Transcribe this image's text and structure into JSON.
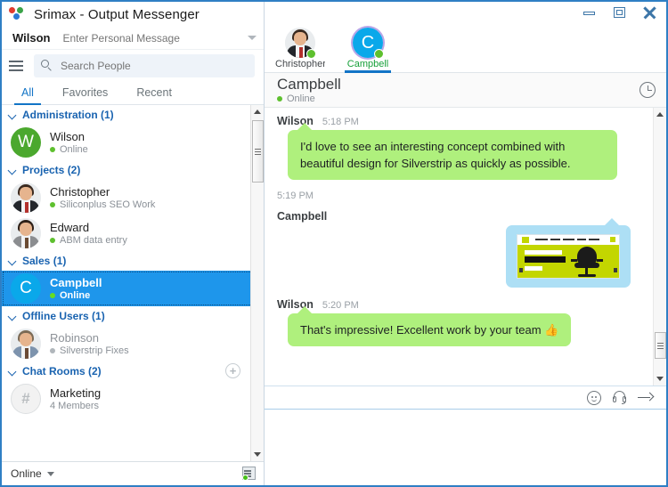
{
  "app": {
    "title": "Srimax - Output Messenger",
    "logo_icon": "three-dots-logo"
  },
  "window_controls": {
    "minimize": "minimize-icon",
    "maximize": "maximize-icon",
    "close": "close-icon"
  },
  "left_panel": {
    "user": {
      "name": "Wilson",
      "personal_message_placeholder": "Enter Personal Message"
    },
    "menu_icon": "hamburger-icon",
    "search": {
      "placeholder": "Search People",
      "icon": "search-icon"
    },
    "tabs": [
      {
        "label": "All",
        "active": true
      },
      {
        "label": "Favorites",
        "active": false
      },
      {
        "label": "Recent",
        "active": false
      }
    ],
    "groups": [
      {
        "label": "Administration (1)",
        "contacts": [
          {
            "name": "Wilson",
            "status": "Online",
            "avatar_type": "letter",
            "avatar_letter": "W",
            "avatar_color": "#4ba82e",
            "selected": false,
            "offline": false
          }
        ]
      },
      {
        "label": "Projects (2)",
        "contacts": [
          {
            "name": "Christopher",
            "status": "Siliconplus SEO Work",
            "avatar_type": "photo",
            "selected": false,
            "offline": false
          },
          {
            "name": "Edward",
            "status": "ABM data entry",
            "avatar_type": "photo",
            "selected": false,
            "offline": false
          }
        ]
      },
      {
        "label": "Sales (1)",
        "contacts": [
          {
            "name": "Campbell",
            "status": "Online",
            "avatar_type": "letter",
            "avatar_letter": "C",
            "avatar_color": "#0aa8ea",
            "selected": true,
            "offline": false
          }
        ]
      },
      {
        "label": "Offline Users (1)",
        "contacts": [
          {
            "name": "Robinson",
            "status": "Silverstrip Fixes",
            "avatar_type": "photo",
            "selected": false,
            "offline": true
          }
        ]
      },
      {
        "label": "Chat Rooms (2)",
        "add_button": "+",
        "contacts": [
          {
            "name": "Marketing",
            "status": "4 Members",
            "avatar_type": "hash",
            "avatar_letter": "#",
            "selected": false,
            "offline": false,
            "no_dot": true
          }
        ]
      }
    ],
    "status_bar": {
      "status": "Online",
      "network_icon": "network-status-icon"
    }
  },
  "chat_panel": {
    "tabs": [
      {
        "label": "Christopher",
        "avatar_type": "photo",
        "presence": "online",
        "active": false
      },
      {
        "label": "Campbell",
        "avatar_type": "letter",
        "avatar_letter": "C",
        "presence": "online",
        "active": true
      }
    ],
    "conversation_header": {
      "name": "Campbell",
      "status": "Online",
      "history_icon": "clock-history-icon"
    },
    "messages": [
      {
        "sender": "Wilson",
        "time": "5:18 PM",
        "direction": "in",
        "type": "text",
        "text": "I'd love to see an interesting concept combined with beautiful design for Silverstrip as quickly as possible."
      },
      {
        "sender": "Campbell",
        "time": "5:19 PM",
        "direction": "out",
        "type": "image",
        "image_alt": "website-screenshot-thumbnail"
      },
      {
        "sender": "Wilson",
        "time": "5:20 PM",
        "direction": "in",
        "type": "text",
        "text": "That's impressive! Excellent work by your team 👍"
      }
    ],
    "composer": {
      "emoji_icon": "emoji-icon",
      "headset_icon": "headset-icon",
      "send_icon": "send-arrow-icon",
      "placeholder": "",
      "value": ""
    }
  }
}
